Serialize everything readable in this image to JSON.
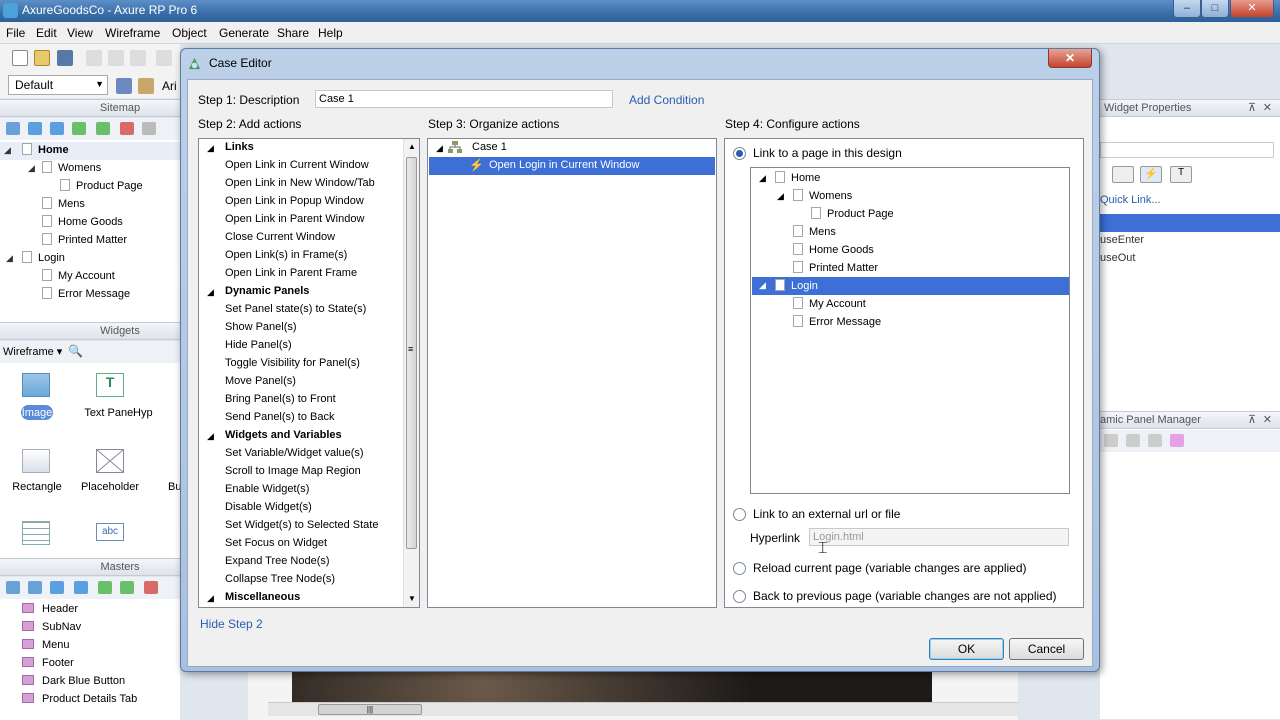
{
  "app": {
    "title": "AxureGoodsCo - Axure RP Pro 6",
    "minimize": "–",
    "maximize": "□",
    "close": "✕"
  },
  "menu": [
    "File",
    "Edit",
    "View",
    "Wireframe",
    "Object",
    "Generate",
    "Share",
    "Help"
  ],
  "toolbar": {
    "style_value": "Default",
    "font_partial": "Ari"
  },
  "sitemap": {
    "title": "Sitemap",
    "pages": [
      "Home",
      "Womens",
      "Product Page",
      "Mens",
      "Home Goods",
      "Printed Matter",
      "Login",
      "My Account",
      "Error Message"
    ]
  },
  "widgets": {
    "title": "Widgets",
    "library": "Wireframe",
    "items": [
      "Image",
      "Text Panel",
      "Hyp",
      "Rectangle",
      "Placeholder",
      "Bu",
      "",
      "abc"
    ]
  },
  "masters": {
    "title": "Masters",
    "items": [
      "Header",
      "SubNav",
      "Menu",
      "Footer",
      "Dark Blue Button",
      "Product Details Tab"
    ]
  },
  "right": {
    "widget_props": "Widget Properties",
    "quick_link": "Quick Link...",
    "events": [
      "useEnter",
      "useOut"
    ],
    "panel_manager": "amic Panel Manager"
  },
  "dialog": {
    "title": "Case Editor",
    "close": "✕",
    "step1": {
      "label": "Step 1: Description",
      "value": "Case 1",
      "add_condition": "Add Condition"
    },
    "step2": {
      "label": "Step 2: Add actions",
      "hide": "Hide Step 2",
      "categories": [
        {
          "name": "Links",
          "items": [
            "Open Link in Current Window",
            "Open Link in New Window/Tab",
            "Open Link in Popup Window",
            "Open Link in Parent Window",
            "Close Current Window",
            "Open Link(s) in Frame(s)",
            "Open Link in Parent Frame"
          ]
        },
        {
          "name": "Dynamic Panels",
          "items": [
            "Set Panel state(s) to State(s)",
            "Show Panel(s)",
            "Hide Panel(s)",
            "Toggle Visibility for Panel(s)",
            "Move Panel(s)",
            "Bring Panel(s) to Front",
            "Send Panel(s) to Back"
          ]
        },
        {
          "name": "Widgets and Variables",
          "items": [
            "Set Variable/Widget value(s)",
            "Scroll to Image Map Region",
            "Enable Widget(s)",
            "Disable Widget(s)",
            "Set Widget(s) to Selected State",
            "Set Focus on Widget",
            "Expand Tree Node(s)",
            "Collapse Tree Node(s)"
          ]
        },
        {
          "name": "Miscellaneous",
          "items": []
        }
      ]
    },
    "step3": {
      "label": "Step 3: Organize actions",
      "case": "Case 1",
      "action": "Open Login in Current Window"
    },
    "step4": {
      "label": "Step 4: Configure actions",
      "opt_page": "Link to a page in this design",
      "pages": [
        "Home",
        "Womens",
        "Product Page",
        "Mens",
        "Home Goods",
        "Printed Matter",
        "Login",
        "My Account",
        "Error Message"
      ],
      "opt_external": "Link to an external url or file",
      "hyperlink_label": "Hyperlink",
      "hyperlink_value": "Login.html",
      "opt_reload": "Reload current page (variable changes are applied)",
      "opt_back": "Back to previous page (variable changes are not applied)"
    },
    "ok": "OK",
    "cancel": "Cancel"
  }
}
